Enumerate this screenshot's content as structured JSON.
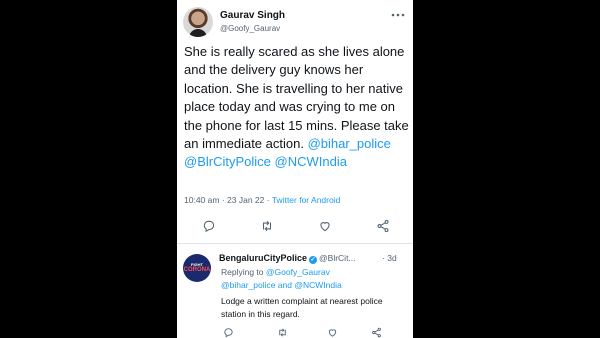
{
  "tweet": {
    "author_name": "Gaurav Singh",
    "author_handle": "@Goofy_Gaurav",
    "text_plain": "She is really scared as she lives alone and the delivery guy knows her location. She is travelling to her native place today and was crying to me on the phone for last 15 mins. Please take an immediate action. ",
    "mentions": [
      "@bihar_police",
      "@BlrCityPolice",
      "@NCWIndia"
    ],
    "time": "10:40 am",
    "separator": "·",
    "date": "23 Jan 22",
    "source": "Twitter for Android",
    "more_icon": "more-dots-icon"
  },
  "reply": {
    "author_name": "BengaluruCityPolice",
    "author_handle": "@BlrCit...",
    "time_separator": "·",
    "time": "3d",
    "avatar_line1": "FIGHT",
    "avatar_line2": "CORONA",
    "replying_to_label": "Replying to",
    "replying_to_handle": "@Goofy_Gaurav",
    "replying_to_more": "@bihar_police and @NCWIndia",
    "text": "Lodge a written complaint at nearest police station in this regard."
  },
  "colors": {
    "accent": "#1d9bf0",
    "text": "#0f1419",
    "muted": "#536471"
  }
}
